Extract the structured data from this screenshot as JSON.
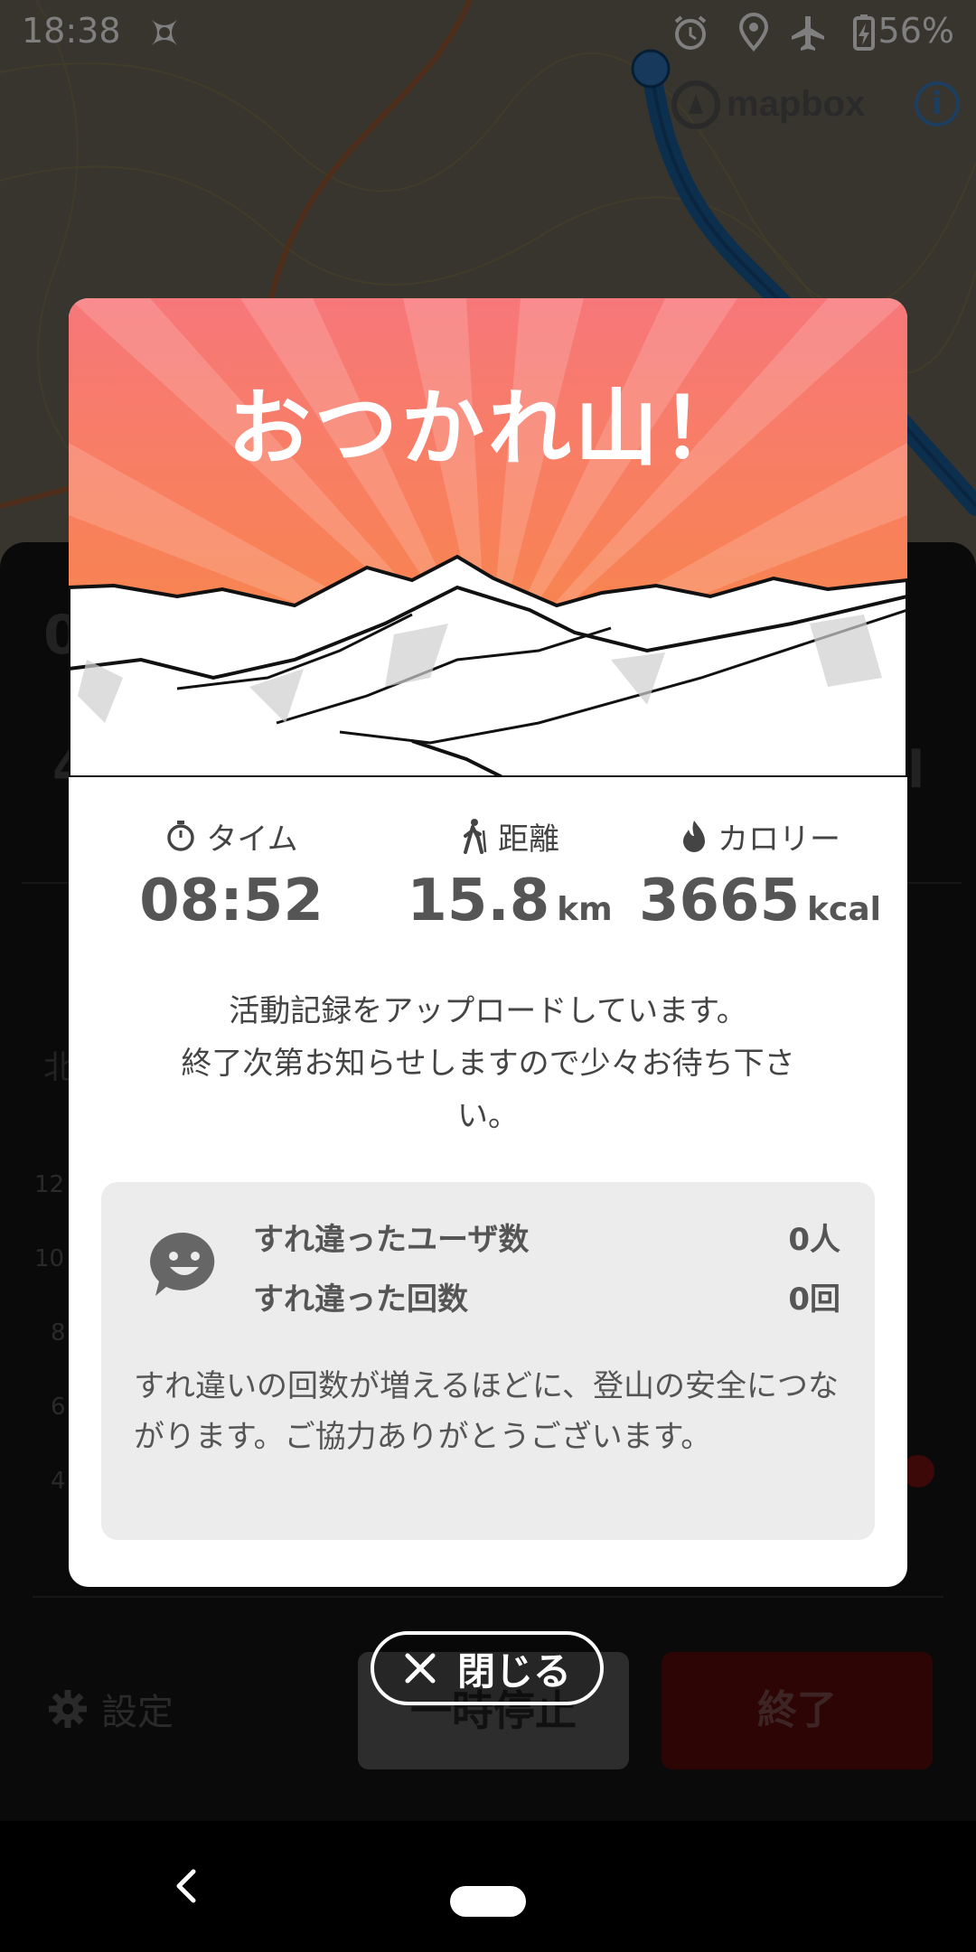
{
  "status_bar": {
    "time": "18:38",
    "battery": "56%"
  },
  "map": {
    "attribution_brand": "mapbox",
    "info_label": "i"
  },
  "background_screen": {
    "ghost_left_top": "0",
    "ghost_left_mid": "4",
    "ghost_right_mid": "l",
    "ghost_left_label": "北",
    "axis_ticks": [
      "12",
      "10",
      "8",
      "6",
      "4"
    ],
    "settings_label": "設定",
    "pause_label": "一時停止",
    "end_label": "終了"
  },
  "modal": {
    "title": "おつかれ山！",
    "stats": [
      {
        "icon": "stopwatch-icon",
        "label": "タイム",
        "value": "08:52",
        "unit": ""
      },
      {
        "icon": "hiker-icon",
        "label": "距離",
        "value": "15.8",
        "unit": "km"
      },
      {
        "icon": "flame-icon",
        "label": "カロリー",
        "value": "3665",
        "unit": "kcal"
      }
    ],
    "upload_message_line1": "活動記録をアップロードしています。",
    "upload_message_line2": "終了次第お知らせしますので少々お待ち下さ",
    "upload_message_line3": "い。",
    "passing": {
      "users_label": "すれ違ったユーザ数",
      "users_value": "0人",
      "count_label": "すれ違った回数",
      "count_value": "0回",
      "note": "すれ違いの回数が増えるほどに、登山の安全につながります。ご協力ありがとうございます。"
    }
  },
  "close_button": {
    "label": "閉じる"
  },
  "colors": {
    "hero_top": "#f7777a",
    "hero_bottom": "#f98b3a",
    "route": "#1b5e9c"
  }
}
